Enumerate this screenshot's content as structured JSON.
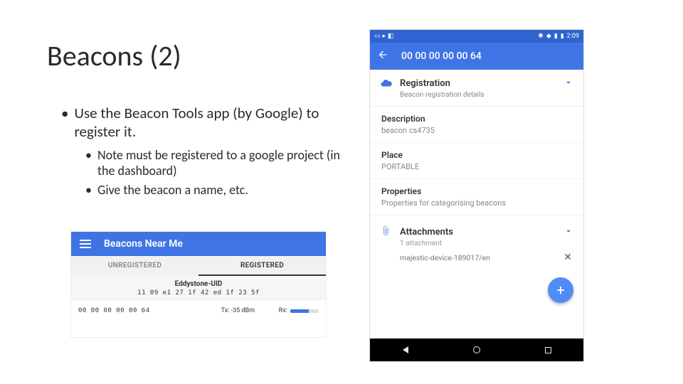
{
  "slide": {
    "title": "Beacons (2)",
    "bullet1": "Use the Beacon Tools app (by Google) to register it.",
    "sub1": "Note must be registered to a google project (in the dashboard)",
    "sub2": "Give the beacon a name, etc."
  },
  "phone_left": {
    "appbar_title": "Beacons Near Me",
    "tabs": {
      "unregistered": "UNREGISTERED",
      "registered": "REGISTERED"
    },
    "section_title": "Eddystone-UID",
    "section_uid": "11 09 e1 27 1f 42 ed 1f 23 5f",
    "row": {
      "id": "00 00 00 00 00 64",
      "tx": "Tx: -35 dBm",
      "rx_label": "Rx:"
    }
  },
  "phone_right": {
    "status": {
      "time": "2:09"
    },
    "appbar_title": "00 00 00 00 00 64",
    "registration": {
      "title": "Registration",
      "subtitle": "Beacon registration details"
    },
    "fields": {
      "description": {
        "label": "Description",
        "value": "beacon cs4735"
      },
      "place": {
        "label": "Place",
        "value": "PORTABLE"
      },
      "properties": {
        "label": "Properties",
        "value": "Properties for categorising beacons"
      }
    },
    "attachments": {
      "title": "Attachments",
      "count": "1 attachment",
      "item": "majestic-device-189017/en"
    }
  }
}
